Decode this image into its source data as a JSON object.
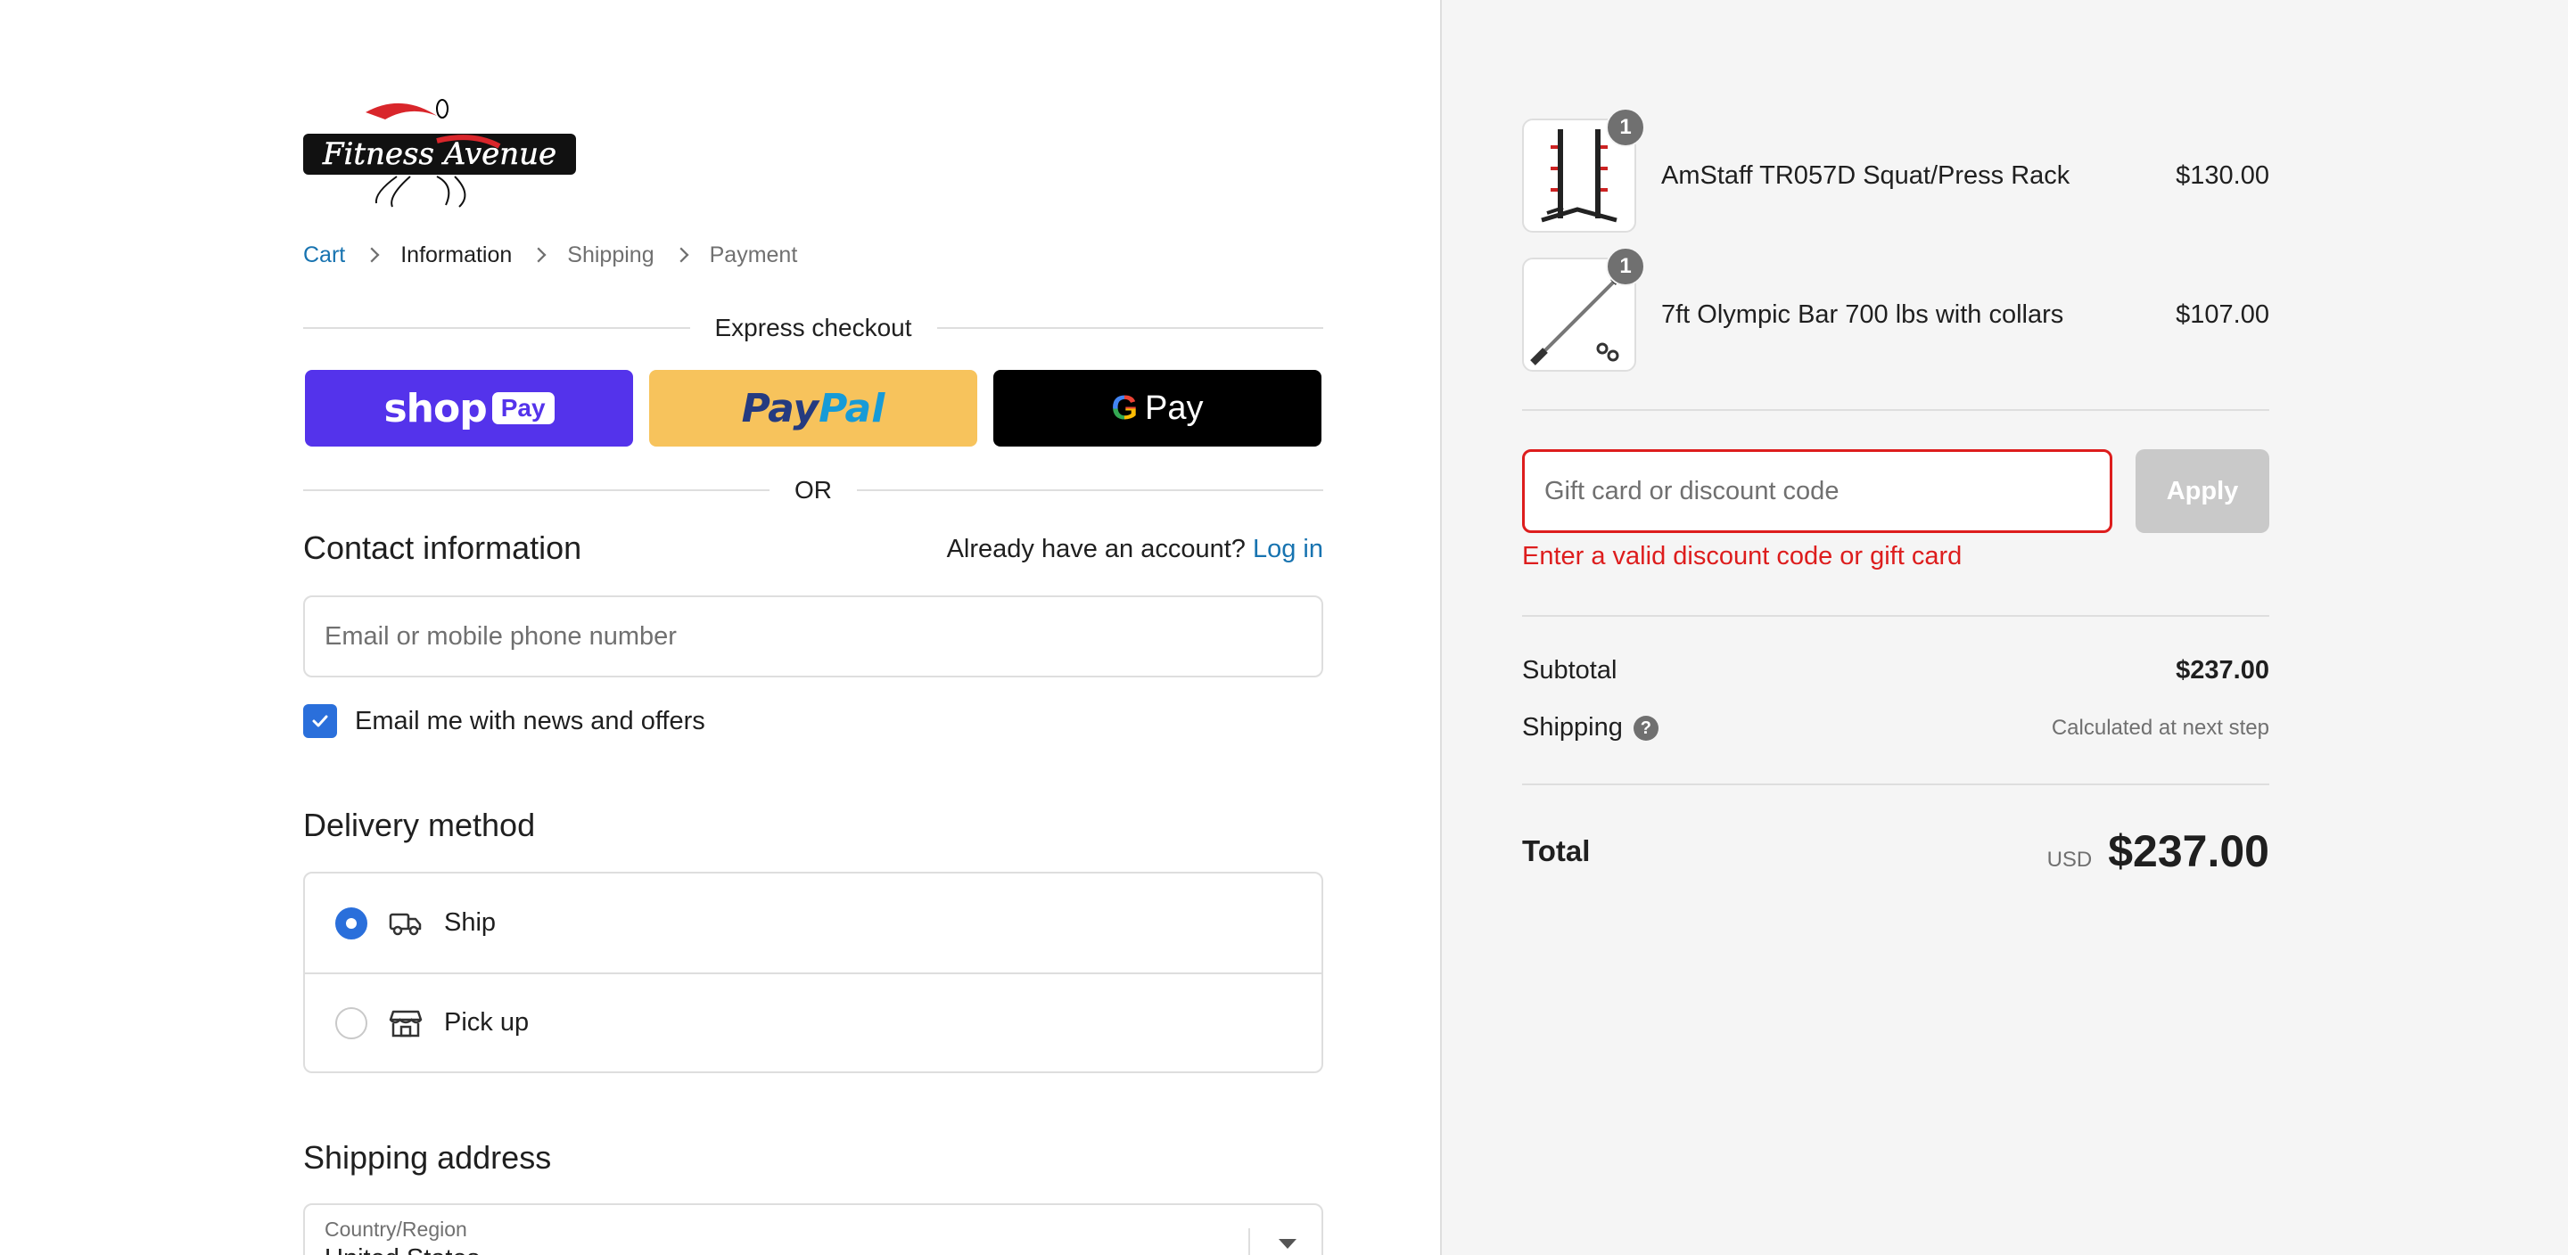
{
  "brand": {
    "logo_text": "Fitness Avenue"
  },
  "breadcrumb": [
    "Cart",
    "Information",
    "Shipping",
    "Payment"
  ],
  "express": {
    "title": "Express checkout",
    "shop_label": "shop",
    "shop_badge": "Pay",
    "paypal_a": "Pay",
    "paypal_b": "Pal",
    "gpay_g": "G",
    "gpay_label": "Pay",
    "or_label": "OR"
  },
  "contact": {
    "heading": "Contact information",
    "account_prompt": "Already have an account?",
    "login_label": "Log in",
    "email_placeholder": "Email or mobile phone number",
    "news_label": "Email me with news and offers",
    "news_checked": true
  },
  "delivery": {
    "heading": "Delivery method",
    "options": [
      {
        "label": "Ship",
        "selected": true,
        "icon": "truck-icon"
      },
      {
        "label": "Pick up",
        "selected": false,
        "icon": "store-icon"
      }
    ]
  },
  "shipping_address": {
    "heading": "Shipping address",
    "country_label": "Country/Region",
    "country_value": "United States"
  },
  "cart": {
    "items": [
      {
        "name": "AmStaff TR057D Squat/Press Rack",
        "price": "$130.00",
        "qty": "1"
      },
      {
        "name": "7ft Olympic Bar 700 lbs with collars",
        "price": "$107.00",
        "qty": "1"
      }
    ],
    "discount_placeholder": "Gift card or discount code",
    "apply_label": "Apply",
    "discount_error": "Enter a valid discount code or gift card",
    "subtotal_label": "Subtotal",
    "subtotal_value": "$237.00",
    "shipping_label": "Shipping",
    "shipping_value": "Calculated at next step",
    "total_label": "Total",
    "currency": "USD",
    "total_value": "$237.00"
  },
  "colors": {
    "accent": "#2a6fdb",
    "link": "#1773b0",
    "error": "#dd1d1d",
    "shop_pay": "#5433eb",
    "paypal": "#f7c35c"
  }
}
